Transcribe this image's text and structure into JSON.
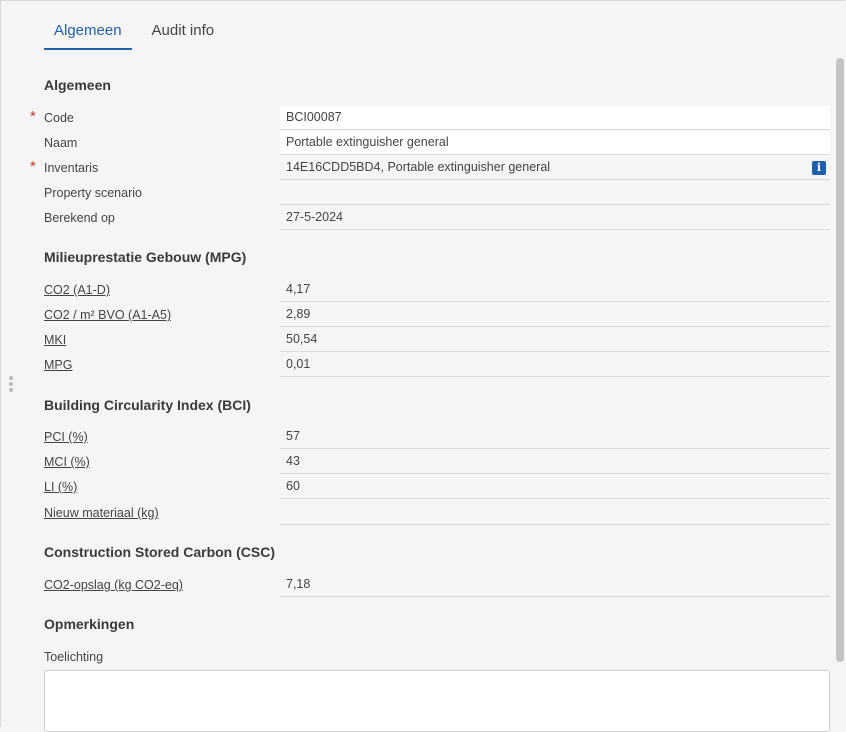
{
  "tabs": [
    {
      "label": "Algemeen"
    },
    {
      "label": "Audit info"
    }
  ],
  "sections": {
    "algemeen": {
      "title": "Algemeen",
      "fields": [
        {
          "label": "Code",
          "value": "BCI00087",
          "required": true
        },
        {
          "label": "Naam",
          "value": "Portable extinguisher general",
          "required": false
        },
        {
          "label": "Inventaris",
          "value": "14E16CDD5BD4, Portable extinguisher general",
          "required": true,
          "icon": "info-icon"
        },
        {
          "label": "Property scenario",
          "value": "",
          "required": false
        },
        {
          "label": "Berekend op",
          "value": "27-5-2024",
          "required": false
        }
      ]
    },
    "mpg": {
      "title": "Milieuprestatie Gebouw (MPG)",
      "fields": [
        {
          "label": "CO2 (A1-D)",
          "value": "4,17"
        },
        {
          "label": "CO2 / m² BVO (A1-A5)",
          "value": "2,89"
        },
        {
          "label": "MKI",
          "value": "50,54"
        },
        {
          "label": "MPG",
          "value": "0,01"
        }
      ]
    },
    "bci": {
      "title": "Building Circularity Index (BCI)",
      "fields": [
        {
          "label": "PCI (%)",
          "value": "57"
        },
        {
          "label": "MCI (%)",
          "value": "43"
        },
        {
          "label": "LI (%)",
          "value": "60"
        },
        {
          "label": "Nieuw materiaal (kg)",
          "value": ""
        }
      ]
    },
    "csc": {
      "title": "Construction Stored Carbon (CSC)",
      "fields": [
        {
          "label": "CO2-opslag (kg CO2-eq)",
          "value": "7,18"
        }
      ]
    },
    "opmerkingen": {
      "title": "Opmerkingen",
      "textarea_label": "Toelichting",
      "textarea_value": ""
    }
  },
  "required_marker": "*",
  "info_icon_glyph": "i",
  "colors": {
    "accent": "#1f5fa8",
    "required": "#c0392b"
  }
}
